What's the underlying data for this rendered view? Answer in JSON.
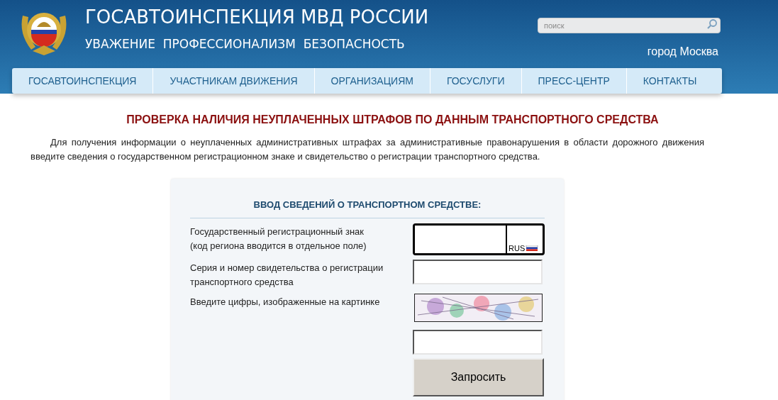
{
  "header": {
    "title": "ГОСАВТОИНСПЕКЦИЯ МВД РОССИИ",
    "slogan": "УВАЖЕНИЕ  ПРОФЕССИОНАЛИЗМ  БЕЗОПАСНОСТЬ",
    "search": {
      "placeholder": "поиск"
    },
    "city": "город Москва"
  },
  "nav": [
    {
      "label": "ГОСАВТОИНСПЕКЦИЯ"
    },
    {
      "label": "УЧАСТНИКАМ ДВИЖЕНИЯ"
    },
    {
      "label": "ОРГАНИЗАЦИЯМ"
    },
    {
      "label": "ГОСУСЛУГИ"
    },
    {
      "label": "ПРЕСС-ЦЕНТР"
    },
    {
      "label": "КОНТАКТЫ"
    }
  ],
  "page": {
    "title": "ПРОВЕРКА НАЛИЧИЯ НЕУПЛАЧЕННЫХ ШТРАФОВ ПО ДАННЫМ ТРАНСПОРТНОГО СРЕДСТВА",
    "intro": "Для получения информации о неуплаченных административных штрафах за административные правонарушения в области дорожного движения введите сведения о государственном регистрационном знаке и свидетельство о регистрации транспортного средства."
  },
  "form": {
    "title": "ВВОД СВЕДЕНИЙ О ТРАНСПОРТНОМ СРЕДСТВЕ:",
    "rows": [
      {
        "kind": "plate",
        "label": "Государственный регистрационный знак\n(код региона вводится в отдельное поле)",
        "country": "RUS"
      },
      {
        "kind": "text",
        "label": "Серия и номер свидетельства о регистрации транспортного средства"
      },
      {
        "kind": "captcha",
        "label": "Введите цифры, изображенные на картинке"
      }
    ],
    "submit": "Запросить"
  }
}
